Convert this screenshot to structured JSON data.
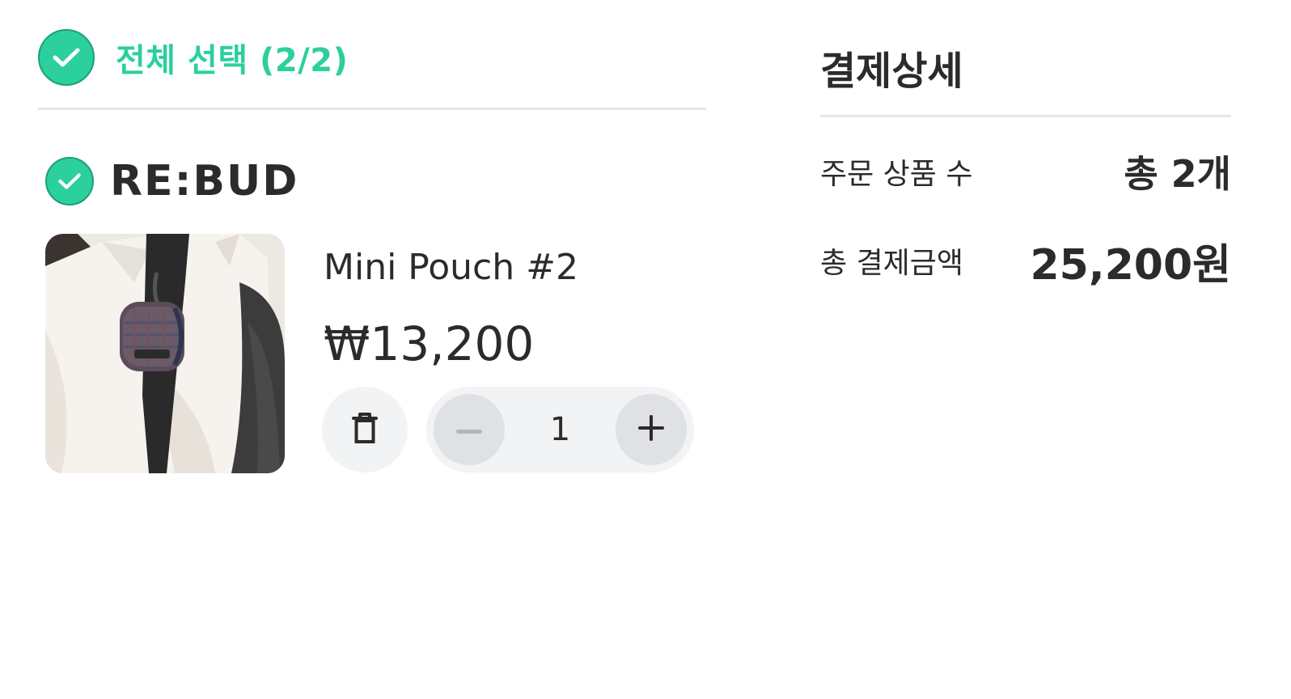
{
  "cart": {
    "select_all_label": "전체 선택 (2/2)",
    "brand": {
      "name": "RE:BUD"
    },
    "item": {
      "name": "Mini Pouch #2",
      "price": "₩13,200",
      "quantity": "1"
    },
    "icons": {
      "select_all": "checkmark-circle-icon",
      "brand_select": "checkmark-circle-icon",
      "delete": "trash-icon",
      "decrement": "minus-icon",
      "increment": "plus-icon"
    }
  },
  "summary": {
    "title": "결제상세",
    "rows": [
      {
        "label": "주문 상품 수",
        "value": "총 2개"
      },
      {
        "label": "총 결제금액",
        "value": "25,200원"
      }
    ]
  },
  "colors": {
    "accent": "#2ccf9e",
    "text": "#2b2b2b",
    "divider": "#e6e6e6",
    "button_bg": "#f2f3f5",
    "stepper_button_bg": "#dfe1e4"
  }
}
